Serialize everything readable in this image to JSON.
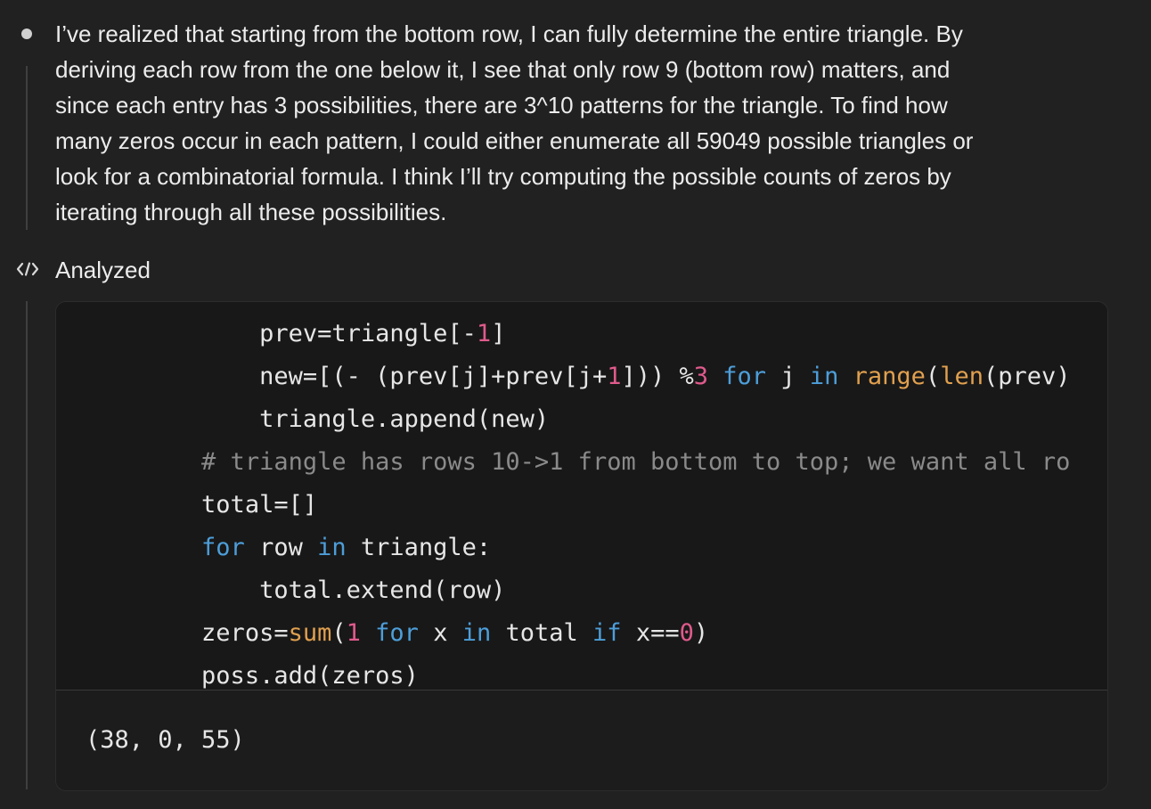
{
  "thought": {
    "lines": [
      "I’ve realized that starting from the bottom row, I can fully determine the entire triangle. By",
      "deriving each row from the one below it, I see that only row 9 (bottom row) matters, and",
      "since each entry has 3 possibilities, there are 3^10 patterns for the triangle. To find how",
      "many zeros occur in each pattern, I could either enumerate all 59049 possible triangles or",
      "look for a combinatorial formula. I think I’ll try computing the possible counts of zeros by",
      "iterating through all these possibilities."
    ]
  },
  "tool": {
    "icon": "code-brackets-icon",
    "status_label": "Analyzed"
  },
  "code": {
    "lines": [
      {
        "indent": "            ",
        "tokens": [
          [
            "t",
            "prev=triangle[-"
          ],
          [
            "n",
            "1"
          ],
          [
            "t",
            "]"
          ]
        ]
      },
      {
        "indent": "            ",
        "tokens": [
          [
            "t",
            "new=[(- (prev[j]+prev[j+"
          ],
          [
            "n",
            "1"
          ],
          [
            "t",
            "])) %"
          ],
          [
            "n",
            "3"
          ],
          [
            "t",
            " "
          ],
          [
            "k",
            "for"
          ],
          [
            "t",
            " j "
          ],
          [
            "k",
            "in"
          ],
          [
            "t",
            " "
          ],
          [
            "f",
            "range"
          ],
          [
            "t",
            "("
          ],
          [
            "f",
            "len"
          ],
          [
            "t",
            "(prev)"
          ]
        ]
      },
      {
        "indent": "            ",
        "tokens": [
          [
            "t",
            "triangle.append(new)"
          ]
        ]
      },
      {
        "indent": "        ",
        "tokens": [
          [
            "c",
            "# triangle has rows 10->1 from bottom to top; we want all ro"
          ]
        ]
      },
      {
        "indent": "        ",
        "tokens": [
          [
            "t",
            "total=[]"
          ]
        ]
      },
      {
        "indent": "        ",
        "tokens": [
          [
            "k",
            "for"
          ],
          [
            "t",
            " row "
          ],
          [
            "k",
            "in"
          ],
          [
            "t",
            " triangle:"
          ]
        ]
      },
      {
        "indent": "            ",
        "tokens": [
          [
            "t",
            "total.extend(row)"
          ]
        ]
      },
      {
        "indent": "        ",
        "tokens": [
          [
            "t",
            "zeros="
          ],
          [
            "f",
            "sum"
          ],
          [
            "t",
            "("
          ],
          [
            "n",
            "1"
          ],
          [
            "t",
            " "
          ],
          [
            "k",
            "for"
          ],
          [
            "t",
            " x "
          ],
          [
            "k",
            "in"
          ],
          [
            "t",
            " total "
          ],
          [
            "k",
            "if"
          ],
          [
            "t",
            " x=="
          ],
          [
            "n",
            "0"
          ],
          [
            "t",
            ")"
          ]
        ]
      },
      {
        "indent": "        ",
        "tokens": [
          [
            "t",
            "poss.add(zeros)"
          ]
        ]
      }
    ]
  },
  "output": {
    "text": "(38, 0, 55)"
  },
  "colors": {
    "background": "#212121",
    "code_background": "#181818",
    "keyword": "#4d9ed9",
    "number": "#e05a8c",
    "builtin": "#e1a04f",
    "comment": "#8a8a8a"
  }
}
